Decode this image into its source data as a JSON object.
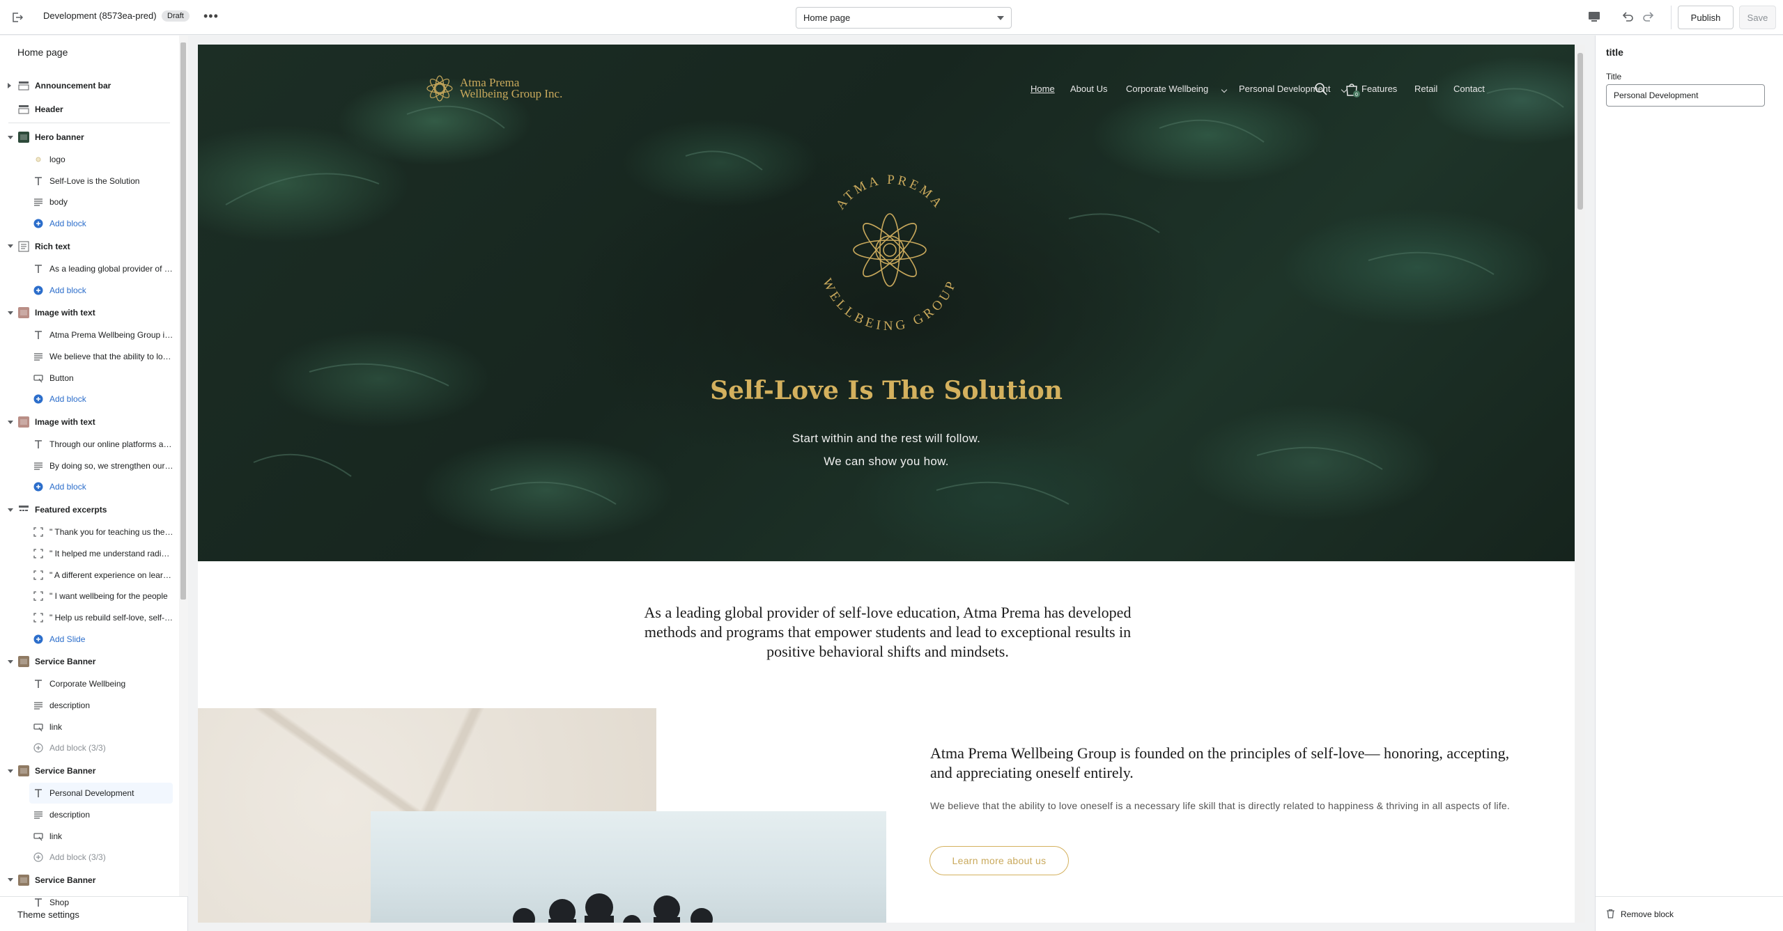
{
  "topbar": {
    "theme_title": "Development (8573ea-pred)",
    "badge": "Draft",
    "more": "•••",
    "page_select": "Home page",
    "publish": "Publish",
    "save": "Save"
  },
  "sidebar": {
    "heading": "Home page",
    "footer": "Theme settings",
    "rows": [
      {
        "type": "section",
        "label": "Announcement bar",
        "expand": "right"
      },
      {
        "type": "section",
        "label": "Header",
        "expand": "none"
      },
      {
        "type": "section",
        "label": "Hero banner",
        "expand": "down"
      },
      {
        "type": "block",
        "label": "logo",
        "icon": "image"
      },
      {
        "type": "block",
        "label": "Self-Love is the Solution",
        "icon": "text"
      },
      {
        "type": "block",
        "label": "body",
        "icon": "paragraph"
      },
      {
        "type": "add",
        "label": "Add block"
      },
      {
        "type": "section",
        "label": "Rich text",
        "expand": "down"
      },
      {
        "type": "block",
        "label": "As a leading global provider of self-love education",
        "icon": "text"
      },
      {
        "type": "add",
        "label": "Add block"
      },
      {
        "type": "section",
        "label": "Image with text",
        "expand": "down"
      },
      {
        "type": "block",
        "label": "Atma Prema Wellbeing Group is founded",
        "icon": "text"
      },
      {
        "type": "block",
        "label": "We believe that the ability to love oneself",
        "icon": "paragraph"
      },
      {
        "type": "block",
        "label": "Button",
        "icon": "button"
      },
      {
        "type": "add",
        "label": "Add block"
      },
      {
        "type": "section",
        "label": "Image with text",
        "expand": "down"
      },
      {
        "type": "block",
        "label": "Through our online platforms and programs",
        "icon": "text"
      },
      {
        "type": "block",
        "label": "By doing so, we strengthen our communities",
        "icon": "paragraph"
      },
      {
        "type": "add",
        "label": "Add block"
      },
      {
        "type": "section",
        "label": "Featured excerpts",
        "expand": "down"
      },
      {
        "type": "block",
        "label": "\" Thank you for teaching us the tools",
        "icon": "slide"
      },
      {
        "type": "block",
        "label": "\" It helped me understand radical self-love",
        "icon": "slide"
      },
      {
        "type": "block",
        "label": "\" A different experience on learning",
        "icon": "slide"
      },
      {
        "type": "block",
        "label": "\" I want wellbeing for the people",
        "icon": "slide"
      },
      {
        "type": "block",
        "label": "\" Help us rebuild self-love, self-care",
        "icon": "slide"
      },
      {
        "type": "add",
        "label": "Add Slide"
      },
      {
        "type": "section",
        "label": "Service Banner",
        "expand": "down"
      },
      {
        "type": "block",
        "label": "Corporate Wellbeing",
        "icon": "text"
      },
      {
        "type": "block",
        "label": "description",
        "icon": "paragraph"
      },
      {
        "type": "block",
        "label": "link",
        "icon": "button"
      },
      {
        "type": "disabled",
        "label": "Add block (3/3)"
      },
      {
        "type": "section",
        "label": "Service Banner",
        "expand": "down"
      },
      {
        "type": "selected",
        "label": "Personal Development",
        "icon": "text"
      },
      {
        "type": "block",
        "label": "description",
        "icon": "paragraph"
      },
      {
        "type": "block",
        "label": "link",
        "icon": "button"
      },
      {
        "type": "disabled",
        "label": "Add block (3/3)"
      },
      {
        "type": "section",
        "label": "Service Banner",
        "expand": "down"
      },
      {
        "type": "block",
        "label": "Shop",
        "icon": "text"
      }
    ]
  },
  "right_panel": {
    "title": "title",
    "field_label": "Title",
    "field_value": "Personal Development",
    "remove": "Remove block"
  },
  "preview": {
    "logo_line1": "Atma Prema",
    "logo_line2": "Wellbeing Group Inc.",
    "nav": [
      "Home",
      "About Us",
      "Corporate Wellbeing",
      "Personal Development",
      "Features",
      "Retail",
      "Contact"
    ],
    "cart_count": "0",
    "emblem_top": "ATMA PREMA",
    "emblem_bottom": "WELLBEING GROUP",
    "hero_heading": "Self-Love Is The Solution",
    "hero_sub1": "Start within and the rest will follow.",
    "hero_sub2": "We can show you how.",
    "rich_text": "As a leading global provider of self-love education, Atma Prema has developed methods and programs that empower students and lead to exceptional results in positive behavioral shifts and mindsets.",
    "iwt_heading": "Atma Prema Wellbeing Group is founded on the principles of self-love— honoring, accepting, and appreciating oneself entirely.",
    "iwt_body": "We believe that the ability to love oneself is a necessary life skill that is directly related to happiness & thriving in all aspects of life.",
    "iwt_button": "Learn more about us"
  },
  "colors": {
    "accent": "#2c6ecb",
    "gold": "#d4b15e",
    "hero_dark": "#17261f"
  }
}
